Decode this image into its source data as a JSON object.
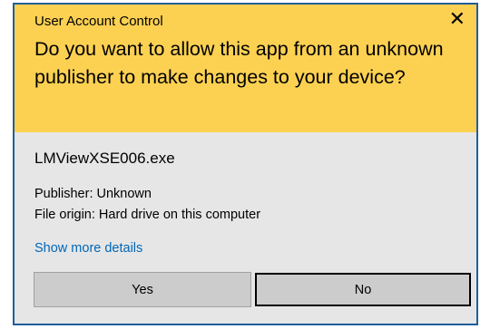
{
  "window": {
    "title": "User Account Control",
    "close_glyph": "✕",
    "close_icon": "close-icon"
  },
  "prompt": {
    "question": "Do you want to allow this app from an unknown publisher to make changes to your device?"
  },
  "app": {
    "name": "LMViewXSE006.exe",
    "publisher": "Publisher: Unknown",
    "origin": "File origin: Hard drive on this computer",
    "details_link": "Show more details"
  },
  "buttons": {
    "yes": "Yes",
    "no": "No"
  },
  "colors": {
    "header": "#fcd152",
    "body": "#e6e6e6",
    "border": "#1f5f9a",
    "link": "#0067b8"
  }
}
